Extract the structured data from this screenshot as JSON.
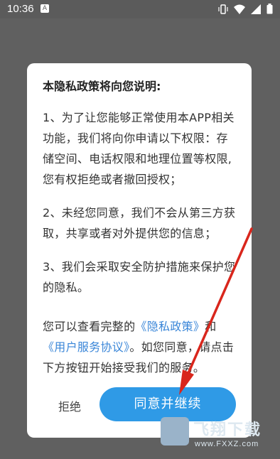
{
  "status_bar": {
    "time": "10:36",
    "left_icon": "A",
    "icons": [
      "vibrate-icon",
      "wifi-icon",
      "signal-icon",
      "battery-icon"
    ]
  },
  "dialog": {
    "title": "本隐私政策将向您说明:",
    "paragraph1": "1、为了让您能够正常使用本APP相关功能，我们将向你申请以下权限：存储空间、电话权限和地理位置等权限,您有权拒绝或者撤回授权；",
    "paragraph2": "2、未经您同意，我们不会从第三方获取，共享或者对外提供您的信息；",
    "paragraph3": "3、我们会采取安全防护措施来保护您的隐私。",
    "paragraph4": {
      "prefix": "您可以查看完整的",
      "privacy_link": "《隐私政策》",
      "and": "和",
      "service_link": "《用户服务协议》",
      "suffix": "。如您同意，请点击下方按钮开始接受我们的服务。"
    },
    "reject_label": "拒绝",
    "agree_label": "同意并继续"
  },
  "watermark": {
    "brand": "飞翔下载",
    "url": "www.FXXZ.com"
  },
  "colors": {
    "overlay": "#606060",
    "accent": "#2f9ae6",
    "link": "#3a86d8",
    "arrow": "#d9261c"
  }
}
